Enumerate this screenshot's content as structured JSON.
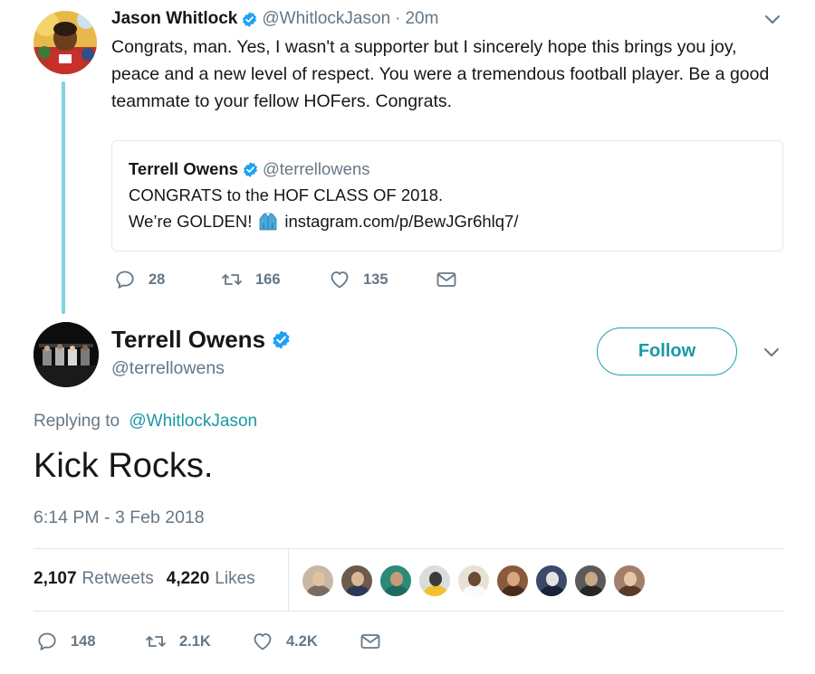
{
  "colors": {
    "accent": "#1a98a6",
    "verified": "#1da1f2",
    "muted": "#657786",
    "text": "#14171a",
    "thread_line": "#7fd3dd",
    "border": "#e1e8ed"
  },
  "parent_tweet": {
    "author_name": "Jason Whitlock",
    "handle": "@WhitlockJason",
    "separator": "·",
    "time": "20m",
    "text": "Congrats, man. Yes, I wasn't a supporter but I sincerely hope this brings you joy, peace and a new level of respect. You were a tremendous football player. Be a good teammate to your fellow HOFers. Congrats.",
    "quote": {
      "author_name": "Terrell Owens",
      "handle": "@terrellowens",
      "line1": "CONGRATS to the HOF CLASS OF 2018.",
      "line2_prefix": "We’re GOLDEN!",
      "emoji_icon": "jacket-icon",
      "link": "instagram.com/p/BewJGr6hlq7/"
    },
    "actions": {
      "replies": "28",
      "retweets": "166",
      "likes": "135"
    }
  },
  "main_tweet": {
    "author_name": "Terrell Owens",
    "handle": "@terrellowens",
    "follow_label": "Follow",
    "replying_prefix": "Replying to",
    "replying_to": "@WhitlockJason",
    "text": "Kick Rocks.",
    "timestamp": "6:14 PM - 3 Feb 2018",
    "stats": {
      "retweets_count": "2,107",
      "retweets_label": "Retweets",
      "likes_count": "4,220",
      "likes_label": "Likes"
    },
    "liker_avatars": [
      {
        "bg": "#c9b8a6",
        "face": "#e0c2a0",
        "body": "#7a6b60"
      },
      {
        "bg": "#6d5a4a",
        "face": "#d9b895",
        "body": "#2c3b55"
      },
      {
        "bg": "#2b8a78",
        "face": "#c89a78",
        "body": "#1f6b5d"
      },
      {
        "bg": "#dcdcdc",
        "face": "#3b3b3b",
        "body": "#f2c12e"
      },
      {
        "bg": "#e8e2d6",
        "face": "#6b4a36",
        "body": "#fafafa"
      },
      {
        "bg": "#8a5a3c",
        "face": "#d7a77f",
        "body": "#4a2c1e"
      },
      {
        "bg": "#3b4a6b",
        "face": "#e3e3e3",
        "body": "#1b2238"
      },
      {
        "bg": "#5a5a5a",
        "face": "#c9a88a",
        "body": "#262626"
      },
      {
        "bg": "#a37e6a",
        "face": "#e8c6a8",
        "body": "#5a3b2b"
      }
    ],
    "actions": {
      "replies": "148",
      "retweets": "2.1K",
      "likes": "4.2K"
    }
  }
}
